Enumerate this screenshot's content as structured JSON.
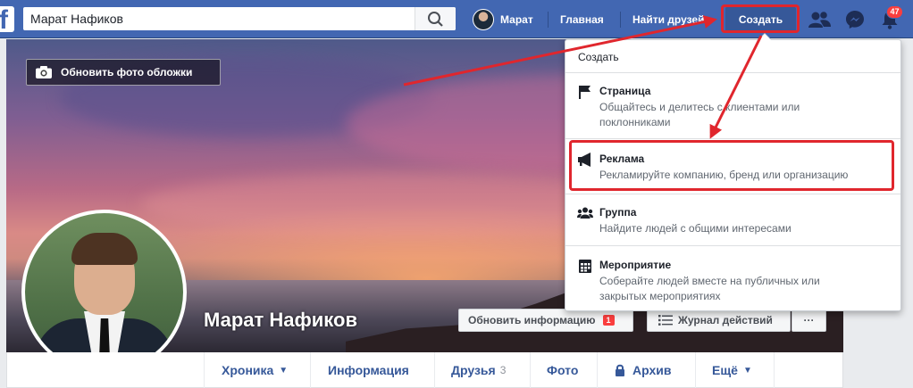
{
  "topbar": {
    "logo": "f",
    "search_value": "Марат Нафиков",
    "user_name": "Марат",
    "home": "Главная",
    "find_friends": "Найти друзей",
    "create": "Создать",
    "notifications_count": "47",
    "icons": [
      "search-icon",
      "friends-icon",
      "messenger-icon",
      "bell-icon"
    ],
    "colors": {
      "bar": "#4267b2",
      "annotation": "#e0262d",
      "badge": "#fa3e3e"
    }
  },
  "cover": {
    "update_cover_label": "Обновить фото обложки",
    "profile_name": "Марат Нафиков",
    "update_info_label": "Обновить информацию",
    "update_info_badge": "1",
    "activity_log_label": "Журнал действий",
    "more_label": "···"
  },
  "tabs": [
    {
      "label": "Хроника",
      "suffix": "▼"
    },
    {
      "label": "Информация"
    },
    {
      "label": "Друзья",
      "count": "3"
    },
    {
      "label": "Фото"
    },
    {
      "label": "Архив",
      "icon": "lock-icon"
    },
    {
      "label": "Ещё",
      "suffix": "▼"
    }
  ],
  "create_menu": {
    "header": "Создать",
    "items": [
      {
        "title": "Страница",
        "desc": "Общайтесь и делитесь с клиентами или поклонниками",
        "icon": "flag-icon"
      },
      {
        "title": "Реклама",
        "desc": "Рекламируйте компанию, бренд или организацию",
        "icon": "megaphone-icon"
      },
      {
        "title": "Группа",
        "desc": "Найдите людей с общими интересами",
        "icon": "group-icon"
      },
      {
        "title": "Мероприятие",
        "desc": "Соберайте людей вместе на публичных или закрытых мероприятиях",
        "icon": "calendar-icon"
      }
    ]
  }
}
